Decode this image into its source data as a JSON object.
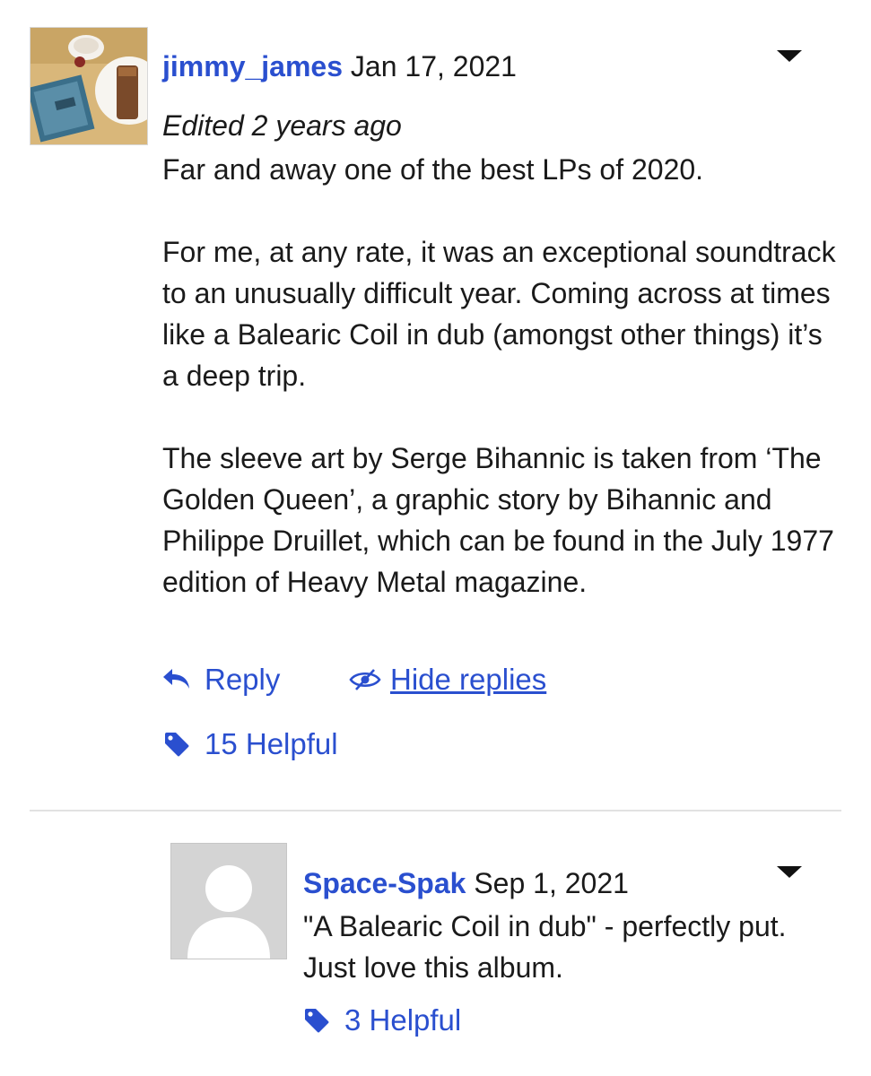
{
  "review": {
    "username": "jimmy_james",
    "date": "Jan 17, 2021",
    "edited": "Edited 2 years ago",
    "body": "Far and away one of the best LPs of 2020.\n\nFor me, at any rate, it was an exceptional soundtrack to an unusually difficult year. Coming across at times like a Balearic Coil in dub (amongst other things) it’s a deep trip.\n\nThe sleeve art by Serge Bihannic is taken from ‘The Golden Queen’, a graphic story by Bihannic and Philippe Druillet, which can be found in the July 1977 edition of Heavy Metal magazine.",
    "reply_label": "Reply",
    "hide_replies_label": "Hide replies",
    "helpful_label": "15 Helpful"
  },
  "reply": {
    "username": "Space-Spak",
    "date": "Sep 1, 2021",
    "body": "\"A Balearic Coil in dub\" - perfectly put. Just love this album.",
    "helpful_label": "3 Helpful"
  },
  "colors": {
    "link": "#2a4fcf",
    "text": "#1a1a1a",
    "divider": "#e2e2e2",
    "avatar_placeholder": "#d4d4d4"
  },
  "icons": {
    "menu": "caret-down-icon",
    "reply": "reply-arrow-icon",
    "hide": "eye-slash-icon",
    "helpful": "tag-icon"
  }
}
